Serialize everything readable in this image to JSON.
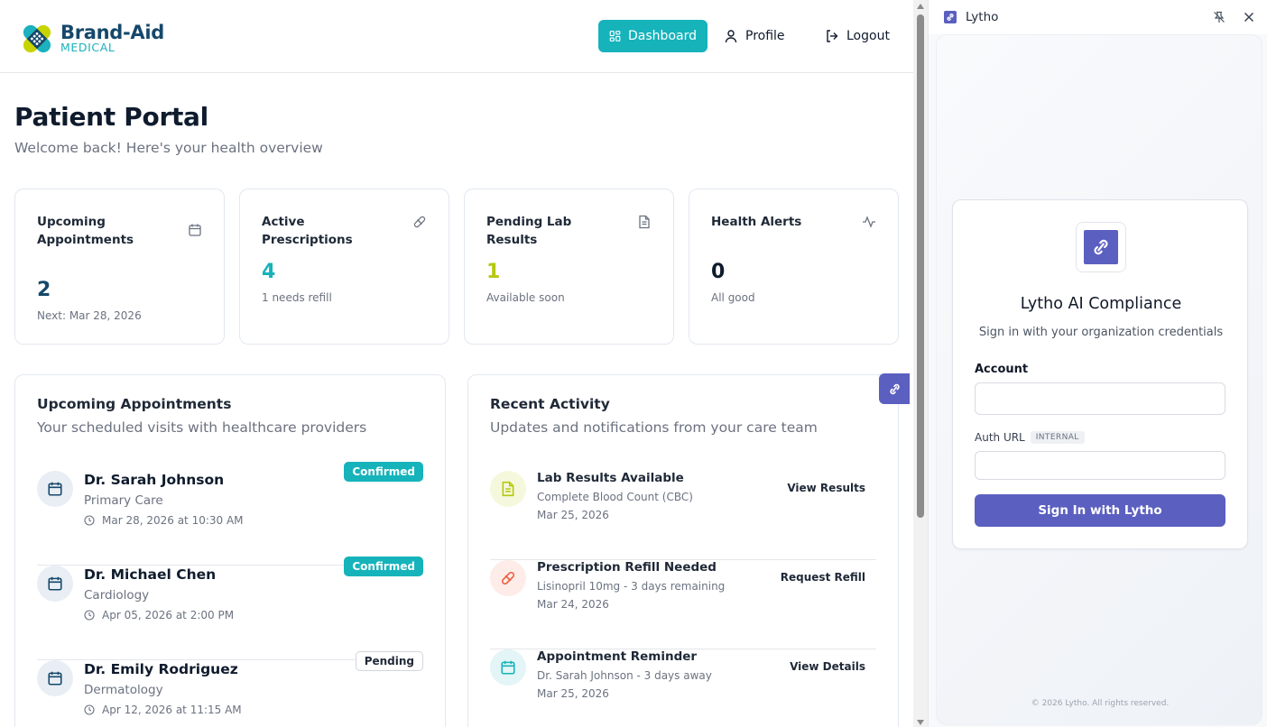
{
  "brand": {
    "name": "Brand-Aid",
    "sub": "MEDICAL"
  },
  "nav": {
    "dashboard": "Dashboard",
    "profile": "Profile",
    "logout": "Logout"
  },
  "page": {
    "title": "Patient Portal",
    "subtitle": "Welcome back! Here's your health overview"
  },
  "stats": [
    {
      "title": "Upcoming Appointments",
      "value": "2",
      "note": "Next: Mar 28, 2026",
      "icon": "calendar-icon",
      "color": "#15486b"
    },
    {
      "title": "Active Prescriptions",
      "value": "4",
      "note": "1 needs refill",
      "icon": "pill-icon",
      "color": "#16b3bb"
    },
    {
      "title": "Pending Lab Results",
      "value": "1",
      "note": "Available soon",
      "icon": "document-icon",
      "color": "#b5c80d"
    },
    {
      "title": "Health Alerts",
      "value": "0",
      "note": "All good",
      "icon": "activity-icon",
      "color": "#0f1b2d"
    }
  ],
  "appointments": {
    "title": "Upcoming Appointments",
    "subtitle": "Your scheduled visits with healthcare providers",
    "items": [
      {
        "doctor": "Dr. Sarah Johnson",
        "specialty": "Primary Care",
        "time": "Mar 28, 2026 at 10:30 AM",
        "status": "Confirmed"
      },
      {
        "doctor": "Dr. Michael Chen",
        "specialty": "Cardiology",
        "time": "Apr 05, 2026 at 2:00 PM",
        "status": "Confirmed"
      },
      {
        "doctor": "Dr. Emily Rodriguez",
        "specialty": "Dermatology",
        "time": "Apr 12, 2026 at 11:15 AM",
        "status": "Pending"
      }
    ]
  },
  "activity": {
    "title": "Recent Activity",
    "subtitle": "Updates and notifications from your care team",
    "items": [
      {
        "title": "Lab Results Available",
        "desc": "Complete Blood Count (CBC)",
        "date": "Mar 25, 2026",
        "action": "View Results",
        "icon": "document-icon",
        "bg": "#f5f8dc",
        "color": "#b5c80d"
      },
      {
        "title": "Prescription Refill Needed",
        "desc": "Lisinopril 10mg - 3 days remaining",
        "date": "Mar 24, 2026",
        "action": "Request Refill",
        "icon": "pill-icon",
        "bg": "#fdece8",
        "color": "#ef5a3c"
      },
      {
        "title": "Appointment Reminder",
        "desc": "Dr. Sarah Johnson - 3 days away",
        "date": "Mar 25, 2026",
        "action": "View Details",
        "icon": "calendar-icon",
        "bg": "#e3f5f6",
        "color": "#16b3bb"
      }
    ]
  },
  "sidepanel": {
    "title": "Lytho",
    "card_title": "Lytho AI Compliance",
    "card_sub": "Sign in with your organization credentials",
    "account_label": "Account",
    "account_value": "",
    "auth_label": "Auth URL",
    "auth_tag": "INTERNAL",
    "auth_value": "",
    "signin": "Sign In with Lytho",
    "footer": "© 2026 Lytho. All rights reserved."
  },
  "colors": {
    "primary": "#16b3bb",
    "brand": "#15486b",
    "lytho": "#5b5fc0"
  }
}
